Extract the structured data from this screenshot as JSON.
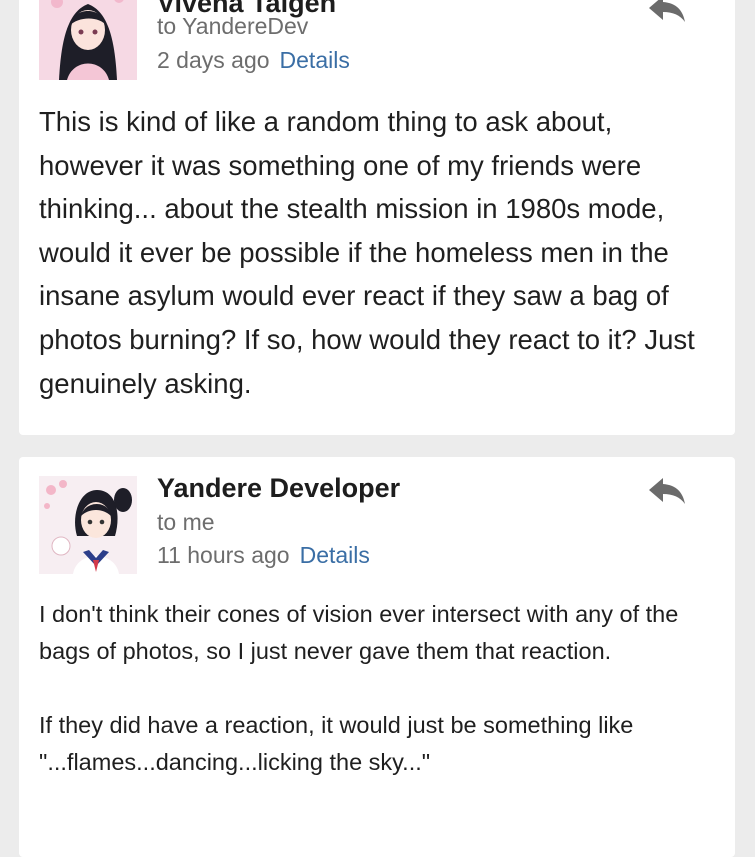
{
  "messages": [
    {
      "sender": "Vivena Taigen",
      "recipient": "to YandereDev",
      "time": "2 days ago",
      "details_label": "Details",
      "reply_icon": "reply-arrow-icon",
      "body": "This is kind of like a random thing to ask about, however it was something one of my friends were thinking... about the stealth mission in 1980s mode, would it ever be possible if the homeless men in the insane asylum would ever react if they saw a bag of photos burning? If so, how would they react to it? Just genuinely asking."
    },
    {
      "sender": "Yandere Developer",
      "recipient": "to me",
      "time": "11 hours ago",
      "details_label": "Details",
      "reply_icon": "reply-arrow-icon",
      "body_paragraphs": [
        "I don't think their cones of vision ever intersect with any of the bags of photos, so I just never gave them that reaction.",
        "If they did have a reaction, it would just be something like \"...flames...dancing...licking the sky...\""
      ]
    }
  ],
  "colors": {
    "background": "#ececec",
    "card": "#ffffff",
    "link": "#3a6ea5",
    "secondary_text": "#6d6d6d"
  }
}
